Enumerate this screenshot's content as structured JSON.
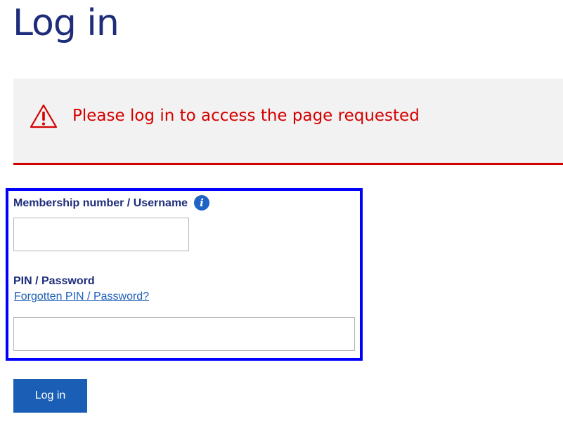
{
  "page": {
    "title": "Log in"
  },
  "alert": {
    "icon": "warning-triangle-icon",
    "message": "Please log in to access the page requested",
    "color": "#d40000"
  },
  "form": {
    "username_label": "Membership number / Username",
    "username_value": "",
    "username_info_icon": "info-icon",
    "password_label": "PIN / Password",
    "password_value": "",
    "forgot_link": "Forgotten PIN / Password?",
    "submit_label": "Log in"
  },
  "colors": {
    "heading": "#1e2c7a",
    "link": "#1f5fb8",
    "button": "#1b5eb5",
    "focus_outline": "#0000ff"
  }
}
